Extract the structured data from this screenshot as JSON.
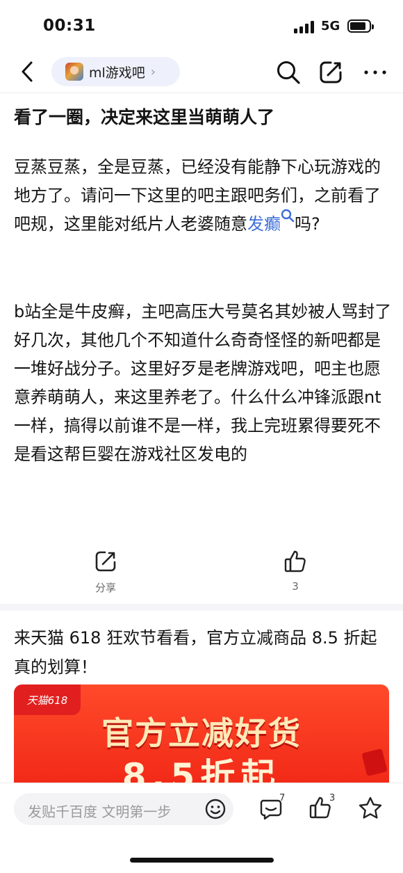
{
  "status_bar": {
    "time": "00:31",
    "network": "5G"
  },
  "nav": {
    "forum_name": "ml游戏吧",
    "chevron": "›"
  },
  "post": {
    "title": "看了一圈，决定来这里当萌萌人了",
    "para1_before": "豆蒸豆蒸，全是豆蒸，已经没有能静下心玩游戏的地方了。请问一下这里的吧主跟吧务们，之前看了吧规，这里能对纸片人老婆随意",
    "para1_keyword": "发癫",
    "para1_after": "吗?",
    "para2": "b站全是牛皮癣，主吧高压大号莫名其妙被人骂封了好几次，其他几个不知道什么奇奇怪怪的新吧都是一堆好战分子。这里好歹是老牌游戏吧，吧主也愿意养萌萌人，来这里养老了。什么什么冲锋派跟nt一样，搞得以前谁不是一样，我上完班累得要死不是看这帮巨婴在游戏社区发电的"
  },
  "actions": {
    "share_label": "分享",
    "like_count": "3"
  },
  "ad": {
    "text": "来天猫 618 狂欢节看看，官方立减商品 8.5 折起真的划算！",
    "tag": "天猫618",
    "headline": "官方立减好货",
    "subline": "8.5折起"
  },
  "bottom_bar": {
    "comment_placeholder": "发贴千百度 文明第一步",
    "comment_count": "7",
    "like_count": "3"
  },
  "colors": {
    "keyword_link": "#3f6fd8",
    "ad_red": "#f22a18"
  }
}
